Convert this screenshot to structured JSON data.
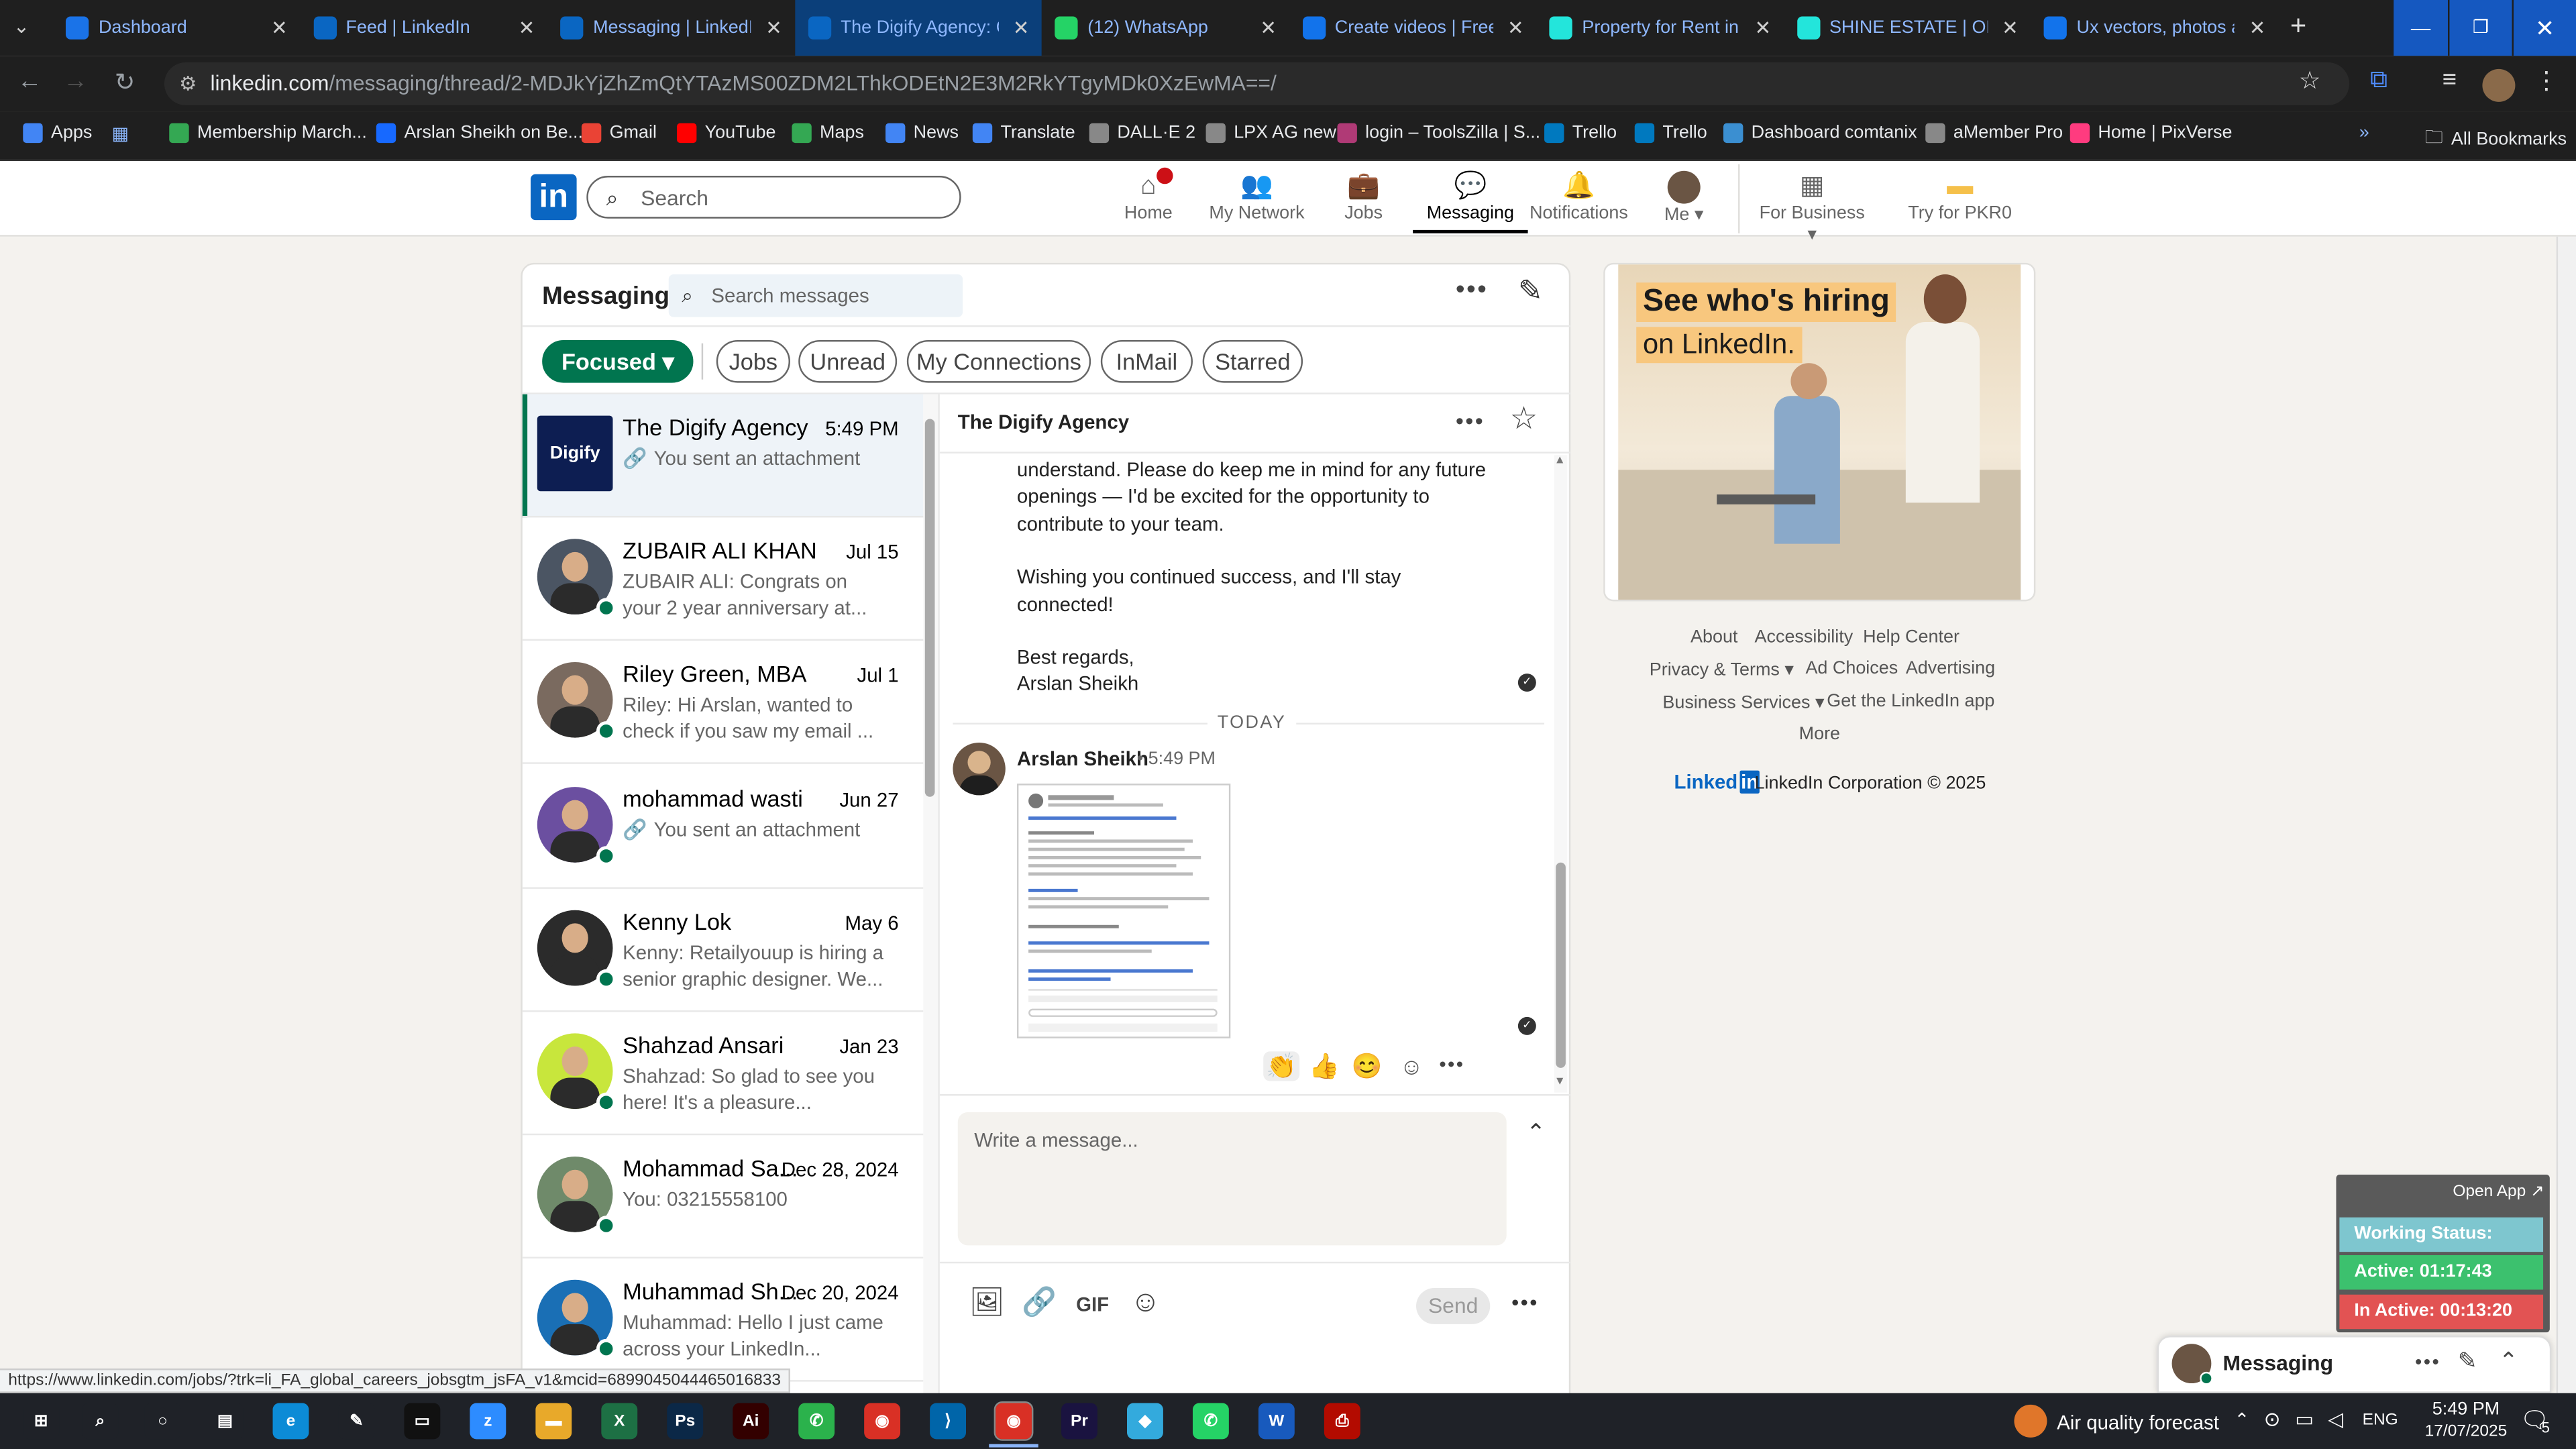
{
  "browser": {
    "tabs": [
      {
        "title": "Dashboard",
        "color": "#1a73e8"
      },
      {
        "title": "Feed | LinkedIn",
        "color": "#0a66c2"
      },
      {
        "title": "Messaging | LinkedIn",
        "color": "#0a66c2"
      },
      {
        "title": "The Digify Agency: Ou",
        "color": "#0a66c2"
      },
      {
        "title": "(12) WhatsApp",
        "color": "#25d366"
      },
      {
        "title": "Create videos | Freep",
        "color": "#1273eb"
      },
      {
        "title": "Property for Rent in S",
        "color": "#23e5db"
      },
      {
        "title": "SHINE ESTATE | OLX",
        "color": "#23e5db"
      },
      {
        "title": "Ux vectors, photos an",
        "color": "#1273eb"
      }
    ],
    "url_host": "linkedin.com",
    "url_path": "/messaging/thread/2-MDJkYjZhZmQtYTAzMS00ZDM2LThkODEtN2E3M2RkYTgyMDk0XzEwMA==/",
    "bookmarks": [
      "Apps",
      "Membership March...",
      "Arslan Sheikh on Be...",
      "Gmail",
      "YouTube",
      "Maps",
      "News",
      "Translate",
      "DALL·E 2",
      "LPX AG new",
      "login – ToolsZilla | S...",
      "Trello",
      "Trello",
      "Dashboard comtanix",
      "aMember Pro",
      "Home | PixVerse"
    ],
    "all_bookmarks": "All Bookmarks"
  },
  "linkedin": {
    "logo": "in",
    "search_placeholder": "Search",
    "nav": [
      {
        "label": "Home",
        "icon": "home-icon"
      },
      {
        "label": "My Network",
        "icon": "network-icon"
      },
      {
        "label": "Jobs",
        "icon": "briefcase-icon"
      },
      {
        "label": "Messaging",
        "icon": "messaging-icon"
      },
      {
        "label": "Notifications",
        "icon": "bell-icon"
      },
      {
        "label": "Me ▾",
        "icon": "avatar"
      },
      {
        "label": "For Business ▾",
        "icon": "grid-icon"
      },
      {
        "label": "Try for PKR0",
        "icon": "premium-icon"
      }
    ]
  },
  "messaging": {
    "title": "Messaging",
    "search_placeholder": "Search messages",
    "filters": [
      "Focused ▾",
      "Jobs",
      "Unread",
      "My Connections",
      "InMail",
      "Starred"
    ],
    "conversations": [
      {
        "name": "The Digify Agency",
        "date": "5:49 PM",
        "preview": "You sent an attachment",
        "attachment": true,
        "avatar_text": "Digify",
        "avatar_color": "#0d1e52"
      },
      {
        "name": "ZUBAIR ALI KHAN",
        "date": "Jul 15",
        "preview": "ZUBAIR ALI: Congrats on your 2 year anniversary at...",
        "avatar_color": "#4b5563"
      },
      {
        "name": "Riley Green, MBA",
        "date": "Jul 1",
        "preview": "Riley: Hi Arslan, wanted to check if you saw my email ...",
        "avatar_color": "#7a6a5f"
      },
      {
        "name": "mohammad wasti",
        "date": "Jun 27",
        "preview": "You sent an attachment",
        "attachment": true,
        "avatar_color": "#6b4fa0"
      },
      {
        "name": "Kenny Lok",
        "date": "May 6",
        "preview": "Kenny: Retailyouup is hiring a senior graphic designer. We...",
        "avatar_color": "#2b2b2b"
      },
      {
        "name": "Shahzad Ansari",
        "date": "Jan 23",
        "preview": "Shahzad: So glad to see you here! It's a pleasure...",
        "avatar_color": "#c8e63c"
      },
      {
        "name": "Mohammad Sa...",
        "date": "Dec 28, 2024",
        "preview": "You: 03215558100",
        "avatar_color": "#6f8a6a"
      },
      {
        "name": "Muhammad Sh...",
        "date": "Dec 20, 2024",
        "preview": "Muhammad: Hello I just came across your LinkedIn...",
        "avatar_color": "#1a6fb5"
      }
    ],
    "thread": {
      "title": "The Digify Agency",
      "lines": [
        "understand. Please do keep me in mind for any future",
        "openings — I'd be excited for the opportunity to",
        "contribute to your team.",
        "",
        "Wishing you continued success, and I'll stay",
        "connected!",
        "",
        "Best regards,",
        "Arslan Sheikh"
      ],
      "divider": "TODAY",
      "sender": "Arslan Sheikh",
      "time": "• 5:49 PM",
      "reactions": [
        "👏",
        "👍",
        "😊"
      ]
    },
    "compose_placeholder": "Write a message...",
    "send_label": "Send",
    "gif_label": "GIF"
  },
  "ad": {
    "headline_1": "See who's hiring",
    "headline_2": "on LinkedIn."
  },
  "footer": {
    "links": [
      "About",
      "Accessibility",
      "Help Center",
      "Privacy & Terms ▾",
      "Ad Choices",
      "Advertising",
      "Business Services ▾",
      "Get the LinkedIn app",
      "More"
    ],
    "brand": "Linked",
    "brand_in": "in",
    "copyright": "LinkedIn Corporation © 2025"
  },
  "widget": {
    "open_app": "Open App ↗",
    "working_status": "Working Status: Active",
    "active": "Active: 01:17:43",
    "inactive": "In Active: 00:13:20"
  },
  "mini_messaging": {
    "title": "Messaging"
  },
  "status_url": "https://www.linkedin.com/jobs/?trk=li_FA_global_careers_jobsgtm_jsFA_v1&mcid=6899045044465016833",
  "taskbar": {
    "air_quality": "Air quality forecast",
    "lang": "ENG",
    "time": "5:49 PM",
    "date": "17/07/2025",
    "notif_count": "5"
  }
}
